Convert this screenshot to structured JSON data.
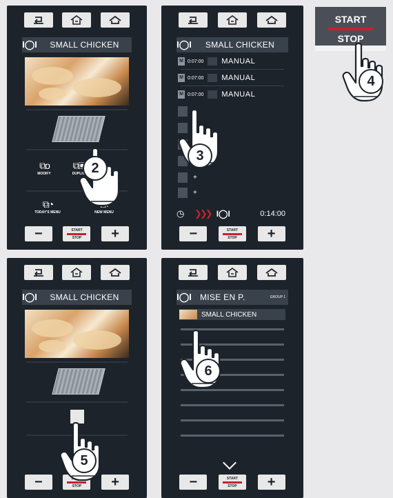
{
  "icons": {
    "back": "back-icon",
    "home": "oven-home-icon",
    "house": "home-icon",
    "plate": "cutlery-plate-icon",
    "hand": "pointing-hand-icon"
  },
  "colors": {
    "panel": "#1d232b",
    "accent": "#c8202f",
    "button": "#e8e8e8"
  },
  "recipe": {
    "name": "SMALL CHICKEN"
  },
  "bottom": {
    "minus": "−",
    "plus": "+",
    "start": "START",
    "stop": "STOP"
  },
  "panel1": {
    "menu": [
      "MODIFY",
      "DUPLIC",
      "TODAY'S MENU",
      "NEW MENU"
    ],
    "callout": "2"
  },
  "panel2": {
    "phases": [
      {
        "time": "0:07:00",
        "label": "MANUAL"
      },
      {
        "time": "0:07:00",
        "label": "MANUAL"
      },
      {
        "time": "0:07:00",
        "label": "MANUAL"
      }
    ],
    "plus_rows": [
      "+",
      "+",
      "+",
      "+",
      "+",
      "+"
    ],
    "total_time": "0:14:00",
    "callout": "3"
  },
  "startstop_big": {
    "start": "START",
    "stop": "STOP",
    "callout": "4"
  },
  "panel3": {
    "callout": "5"
  },
  "panel4": {
    "title": "MISE EN P.",
    "group": "GROUP 1",
    "list": [
      "SMALL CHICKEN"
    ],
    "callout": "6"
  }
}
